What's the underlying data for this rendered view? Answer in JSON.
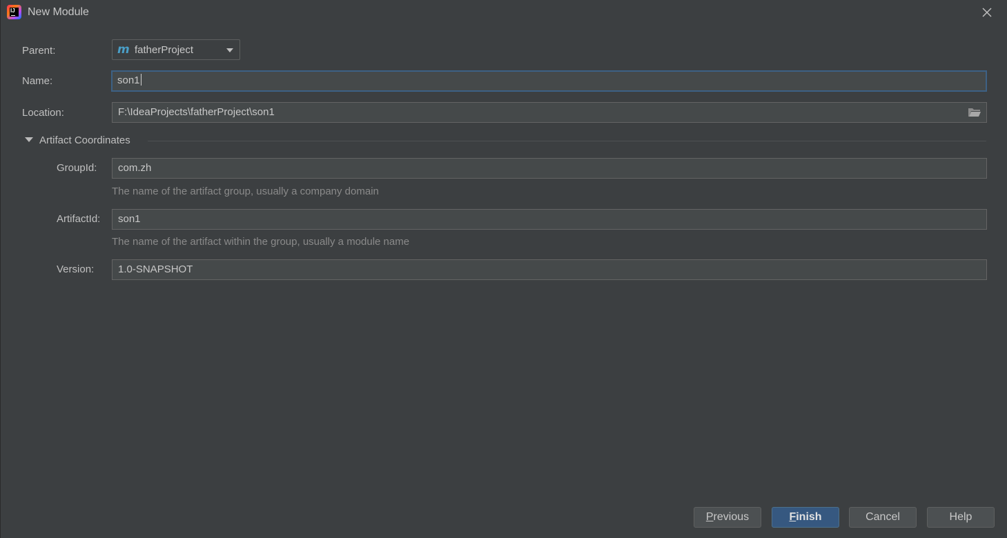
{
  "window": {
    "title": "New Module"
  },
  "form": {
    "parent_label": "Parent:",
    "parent_value": "fatherProject",
    "name_label": "Name:",
    "name_value": "son1",
    "location_label": "Location:",
    "location_value": "F:\\IdeaProjects\\fatherProject\\son1"
  },
  "artifact": {
    "section_title": "Artifact Coordinates",
    "group_label": "GroupId:",
    "group_value": "com.zh",
    "group_hint": "The name of the artifact group, usually a company domain",
    "artifact_label": "ArtifactId:",
    "artifact_value": "son1",
    "artifact_hint": "The name of the artifact within the group, usually a module name",
    "version_label": "Version:",
    "version_value": "1.0-SNAPSHOT"
  },
  "buttons": {
    "previous_mnemonic": "P",
    "previous_rest": "revious",
    "finish_mnemonic": "F",
    "finish_rest": "inish",
    "cancel": "Cancel",
    "help": "Help"
  },
  "icons": {
    "app": "intellij-idea-icon",
    "close": "close-icon",
    "maven": "maven-module-icon",
    "dropdown": "chevron-down-icon",
    "folder": "folder-icon",
    "collapse": "triangle-down-icon"
  },
  "colors": {
    "background": "#3c3f41",
    "field_background": "#45494a",
    "focus_border": "#3d6185",
    "primary_button": "#365880",
    "hint_text": "#8a8a8a"
  }
}
